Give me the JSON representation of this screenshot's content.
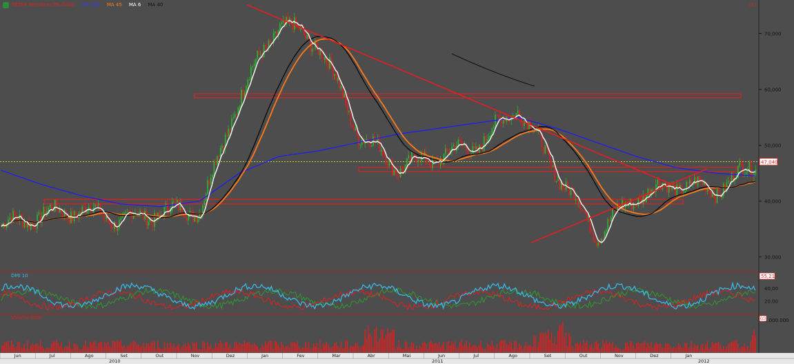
{
  "legend": {
    "ticker": "PETR4 Petrobras PN diário",
    "ma200": "MA 200",
    "ma45": "MA 45",
    "ma6": "MA 6",
    "ma40": "MA 40"
  },
  "panels": {
    "dmi_label": "DMI 10",
    "volume_label": "Volume total"
  },
  "colors": {
    "background": "#4d4d4d",
    "ma200": "#1a1aff",
    "ma45": "#ff7a1a",
    "ma6": "#ffffff",
    "ma40": "#000000",
    "up_candle": "#2fb52f",
    "down_candle": "#e02020",
    "trendline": "#e02020",
    "last_price_line": "#ffff33",
    "dmi_plus": "#2e9b2e",
    "dmi_minus": "#e02020",
    "adx": "#3ab8e8",
    "volume": "#e02020"
  },
  "chart_data": {
    "type": "candlestick",
    "x_month_labels": [
      "Jun",
      "Jul",
      "Ago",
      "Set",
      "Out",
      "Nov",
      "Dez",
      "Jan",
      "Fev",
      "Mar",
      "Abr",
      "Mai",
      "Jun",
      "Jul",
      "Ago",
      "Set",
      "Out",
      "Nov",
      "Dez",
      "Jan"
    ],
    "x_year_labels": [
      "2010",
      "2011",
      "2012"
    ],
    "price_axis": {
      "ticks": [
        "30,000",
        "40,000",
        "50,000",
        "60,000",
        "70,000"
      ],
      "tick_values": [
        30000,
        40000,
        50000,
        60000,
        70000
      ],
      "ylim": [
        27500,
        75500
      ]
    },
    "last_price": {
      "value": 47040,
      "label": "47,040"
    },
    "price_corner_label": "(1)",
    "close_series_monthly": [
      35500,
      37500,
      38500,
      36500,
      38000,
      38500,
      59000,
      72000,
      68000,
      52000,
      46000,
      48000,
      50000,
      57000,
      45000,
      34000,
      41000,
      43000,
      42000,
      46500
    ],
    "ma200_monthly": [
      45500,
      43000,
      41000,
      39500,
      39000,
      40000,
      45000,
      48000,
      49000,
      50500,
      52000,
      53000,
      54000,
      55000,
      53000,
      50500,
      48000,
      46000,
      45000,
      44500
    ],
    "horizontal_zones": [
      {
        "from": 58500,
        "to": 59200,
        "name": "resistance-60000"
      },
      {
        "from": 45300,
        "to": 46100,
        "name": "zone-46000"
      },
      {
        "from": 39500,
        "to": 40300,
        "name": "zone-40000"
      }
    ],
    "dmi_axis": {
      "ticks": [
        "20,00",
        "40,00"
      ],
      "tick_values": [
        20,
        40
      ],
      "corner_label": "55,21",
      "ylim": [
        0,
        65
      ]
    },
    "volume_axis": {
      "ticks": [
        "5.000.000"
      ],
      "tick_values": [
        5000000
      ],
      "corner_label": "(c)"
    }
  }
}
